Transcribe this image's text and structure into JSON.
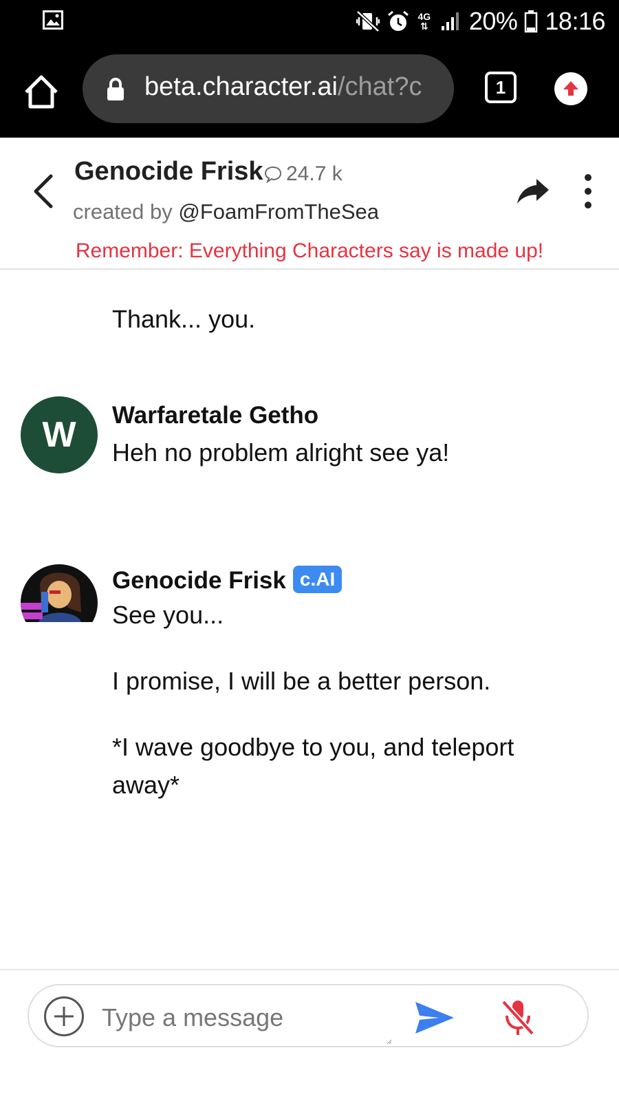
{
  "status_bar": {
    "icons": [
      "gallery-icon",
      "mute-vibrate-icon",
      "alarm-icon",
      "network-4g-icon",
      "signal-icon",
      "battery-icon"
    ],
    "network": "4G",
    "battery": "20%",
    "time": "18:16"
  },
  "browser": {
    "url_host": "beta.character.ai",
    "url_path": "/chat?c",
    "tab_count": "1",
    "icons": [
      "home-icon",
      "lock-icon",
      "tabs-icon",
      "update-arrow-icon"
    ]
  },
  "chat_header": {
    "character_name": "Genocide Frisk",
    "chat_count": "24.7 k",
    "created_by_label": "created by",
    "creator_handle": "@FoamFromTheSea",
    "warning": "Remember: Everything Characters say is made up!",
    "icons": [
      "back-arrow-icon",
      "chat-bubble-icon",
      "share-icon",
      "more-vertical-icon"
    ]
  },
  "messages": [
    {
      "text": "Thank... you."
    },
    {
      "author": "Warfaretale Getho",
      "avatar_letter": "W",
      "text": "Heh no problem alright see ya!"
    },
    {
      "author": "Genocide Frisk",
      "badge": "c.AI",
      "lines": [
        "See you...",
        "I promise, I will be a better person.",
        "*I wave goodbye to you, and teleport away*"
      ]
    }
  ],
  "composer": {
    "placeholder": "Type a message",
    "icons": [
      "plus-circle-icon",
      "send-icon",
      "mic-off-icon"
    ]
  },
  "colors": {
    "warning": "#e53341",
    "badge": "#3d8bf0",
    "send": "#3d7ef0",
    "mic_off": "#e53341",
    "user_avatar": "#1d4d36"
  }
}
